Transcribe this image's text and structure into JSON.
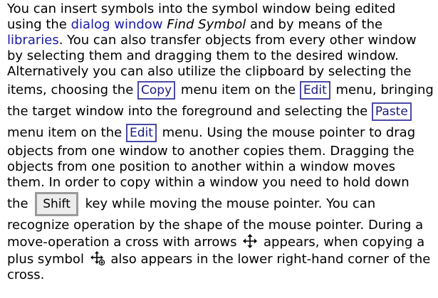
{
  "text": {
    "s1_a": "You can insert symbols into the symbol window being edited using the ",
    "s1_link1": "dialog window",
    "s1_space": " ",
    "s1_italic": "Find Symbol",
    "s1_b": " and by means of the ",
    "s1_link2": "libraries",
    "s1_c": ". You can also transfer objects from every other window by selecting them and dragging them to the desired window. Alternatively you can also utilize the clipboard by selecting the items, choosing the ",
    "copy_item": "Copy",
    "s2_a": " menu item on the ",
    "edit_menu_1": "Edit",
    "s2_b": " menu, bringing the target window into the foreground and selecting the ",
    "paste_item": "Paste",
    "s2_c": " menu item on the ",
    "edit_menu_2": "Edit",
    "s2_d": " menu. Using the mouse pointer to drag objects from one window to another copies them. Dragging the objects from one position to another within a window moves them. In order to copy within a window you need to hold down the ",
    "shift_key": "Shift",
    "s3_a": " key while moving the mouse pointer. You can recognize operation by the shape of the mouse pointer. During a move-operation a cross with arrows ",
    "s3_b": " appears, when copying a plus symbol ",
    "s3_c": " also appears in the lower right-hand corner of the cross."
  },
  "icons": {
    "move_cursor": "move-cross-arrows-icon",
    "copy_cursor": "copy-cross-plus-icon"
  },
  "colors": {
    "link": "#1a1aa6",
    "menu_border": "#4a4aa8",
    "key_border": "#9a9a9a",
    "key_background": "#ececec"
  }
}
